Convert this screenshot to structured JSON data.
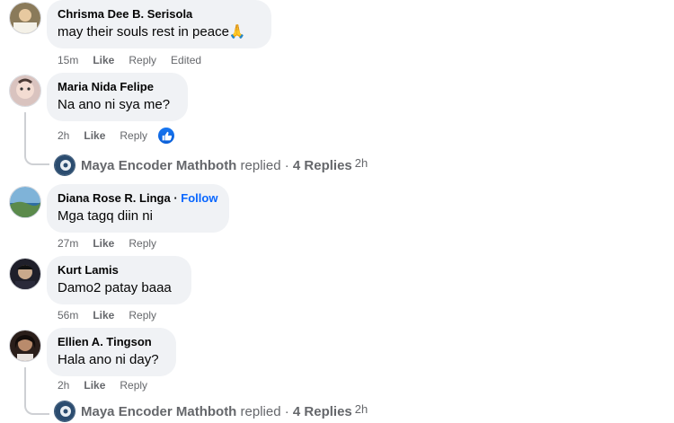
{
  "comments": [
    {
      "author": "Chrisma Dee B. Serisola",
      "text": "may their souls rest in peace",
      "emoji": "🙏",
      "time": "15m",
      "like": "Like",
      "reply": "Reply",
      "edited": "Edited"
    },
    {
      "author": "Maria Nida Felipe",
      "text": "Na ano ni sya me?",
      "time": "2h",
      "like": "Like",
      "reply": "Reply",
      "reaction_icon": "like-reaction-icon",
      "replies": {
        "name": "Maya Encoder Mathboth",
        "verb": "replied",
        "sep": "·",
        "count": "4 Replies",
        "time": "2h"
      }
    },
    {
      "author": "Diana Rose R. Linga",
      "follow_sep": "·",
      "follow": "Follow",
      "text": "Mga tagq diin ni",
      "time": "27m",
      "like": "Like",
      "reply": "Reply"
    },
    {
      "author": "Kurt Lamis",
      "text": "Damo2 patay baaa",
      "time": "56m",
      "like": "Like",
      "reply": "Reply"
    },
    {
      "author": "Ellien A. Tingson",
      "text": "Hala ano ni day?",
      "time": "2h",
      "like": "Like",
      "reply": "Reply",
      "replies": {
        "name": "Maya Encoder Mathboth",
        "verb": "replied",
        "sep": "·",
        "count": "4 Replies",
        "time": "2h"
      }
    }
  ],
  "colors": {
    "bubble": "#f0f2f5",
    "meta": "#65676b",
    "follow": "#0866ff",
    "like_badge": "#1877f2"
  }
}
